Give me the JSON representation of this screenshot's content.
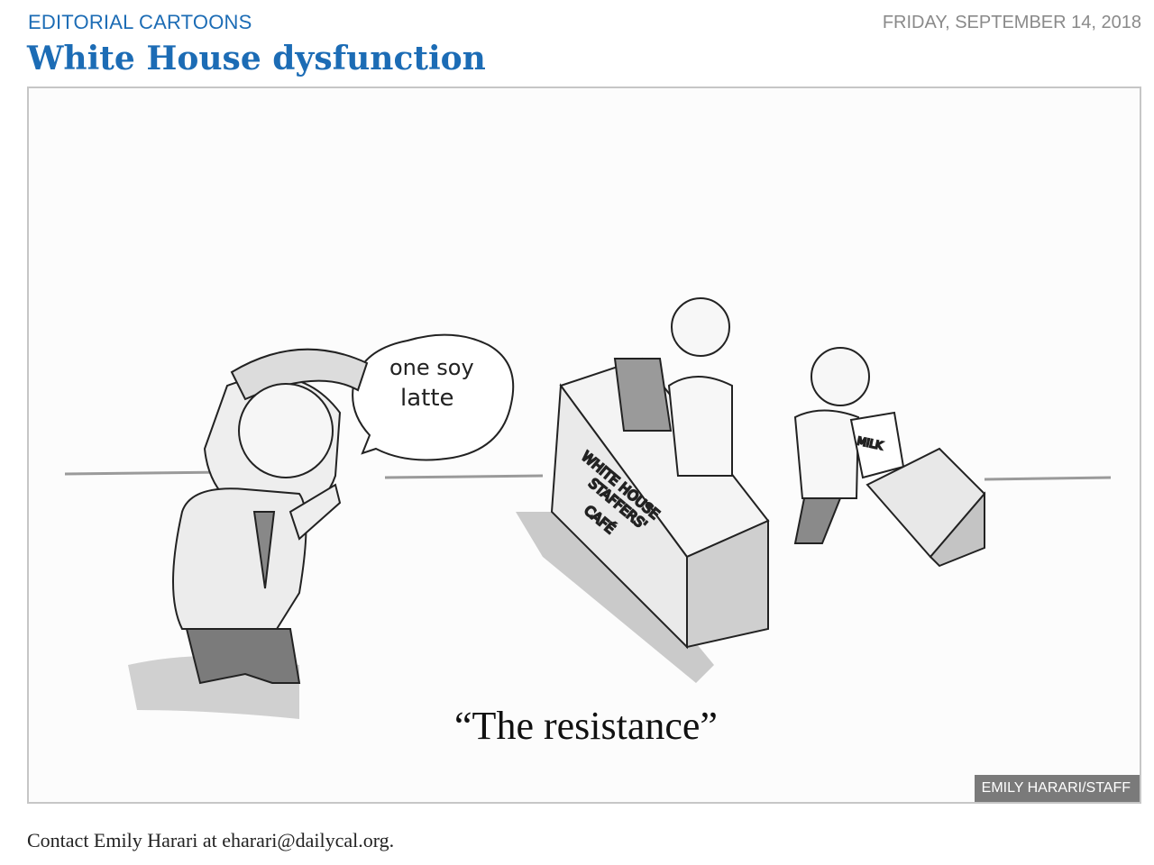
{
  "header": {
    "section": "EDITORIAL CARTOONS",
    "date": "FRIDAY, SEPTEMBER 14, 2018"
  },
  "article": {
    "title": "White House dysfunction"
  },
  "cartoon": {
    "speech_line1": "one soy",
    "speech_line2": "latte",
    "counter_line1": "WHITE HOUSE",
    "counter_line2": "STAFFERS'",
    "counter_line3": "CAFÉ",
    "milk_label": "MILK",
    "caption": "“The resistance”",
    "credit": "EMILY HARARI/STAFF"
  },
  "footer": {
    "contact": "Contact Emily Harari at eharari@dailycal.org."
  }
}
